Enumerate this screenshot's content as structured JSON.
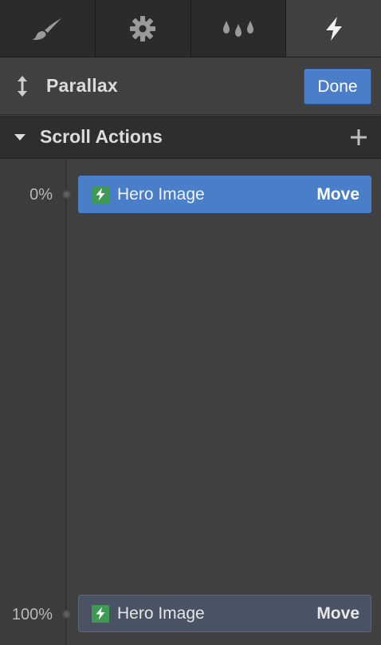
{
  "tabs": [
    {
      "icon": "brush-icon",
      "active": false
    },
    {
      "icon": "gear-icon",
      "active": false
    },
    {
      "icon": "drops-icon",
      "active": false
    },
    {
      "icon": "bolt-icon",
      "active": true
    }
  ],
  "header": {
    "icon": "up-down-arrow-icon",
    "title": "Parallax",
    "done_label": "Done"
  },
  "section": {
    "title": "Scroll Actions",
    "add_icon": "plus-icon"
  },
  "timeline": {
    "steps": [
      {
        "percent": "0%",
        "target": "Hero Image",
        "action": "Move",
        "selected": true
      },
      {
        "percent": "100%",
        "target": "Hero Image",
        "action": "Move",
        "selected": false
      }
    ]
  },
  "colors": {
    "accent": "#4a7ec9",
    "badge_green": "#3f9a54",
    "panel_bg": "#404040",
    "tabbar_bg": "#2b2b2b"
  }
}
